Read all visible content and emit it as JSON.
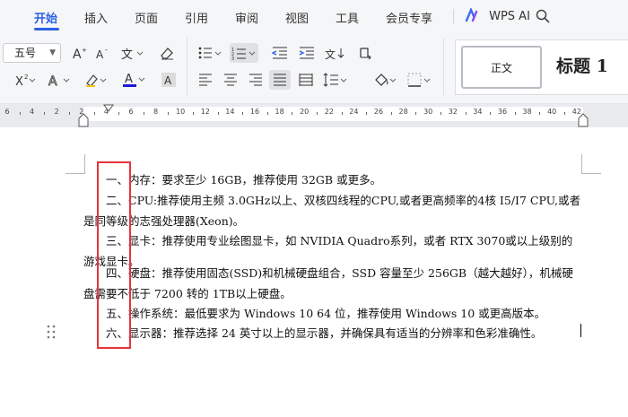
{
  "menu": {
    "tabs": [
      "开始",
      "插入",
      "页面",
      "引用",
      "审阅",
      "视图",
      "工具",
      "会员专享"
    ],
    "active_index": 0,
    "ai_label": "WPS AI",
    "search_icon": "search-icon"
  },
  "ribbon": {
    "font_size": "五号",
    "style_normal": "正文",
    "style_heading": "标题 1",
    "icons": [
      "font-grow-icon",
      "font-shrink-icon",
      "phonetic-guide-icon",
      "eraser-icon",
      "superscript-icon",
      "text-effect-icon",
      "highlighter-icon",
      "font-color-icon",
      "character-shading-icon",
      "bullet-list-icon",
      "numbered-list-icon",
      "decrease-indent-icon",
      "increase-indent-icon",
      "paragraph-sort-icon",
      "show-marks-icon",
      "align-left-icon",
      "align-center-icon",
      "align-right-icon",
      "justify-icon",
      "distributed-align-icon",
      "line-spacing-icon",
      "shading-icon",
      "borders-icon"
    ],
    "font_color": "#1a1ad6",
    "accent": "#2b5fe4"
  },
  "ruler": {
    "labels": [
      "6",
      "4",
      "2",
      "2",
      "4",
      "6",
      "8",
      "10",
      "12",
      "14",
      "16",
      "18",
      "20",
      "22",
      "24",
      "26",
      "28",
      "30",
      "32",
      "34",
      "36",
      "38",
      "40",
      "42"
    ]
  },
  "document": {
    "paragraphs": [
      "一、内存：要求至少 16GB，推荐使用 32GB 或更多。",
      "二、CPU:推荐使用主频 3.0GHz以上、双核四线程的CPU,或者更高频率的4核 I5/I7 CPU,或者是同等级的志强处理器(Xeon)。",
      "三、显卡：推荐使用专业绘图显卡，如 NVIDIA Quadro系列，或者 RTX 3070或以上级别的游戏显卡。",
      "四、硬盘：推荐使用固态(SSD)和机械硬盘组合，SSD 容量至少 256GB（越大越好），机械硬盘需要不低于 7200 转的 1TB以上硬盘。",
      "五、操作系统：最低要求为 Windows 10 64 位，推荐使用 Windows 10 或更高版本。",
      "六、显示器：推荐选择 24 英寸以上的显示器，并确保具有适当的分辨率和色彩准确性。"
    ],
    "highlight_color": "#e8333a"
  }
}
